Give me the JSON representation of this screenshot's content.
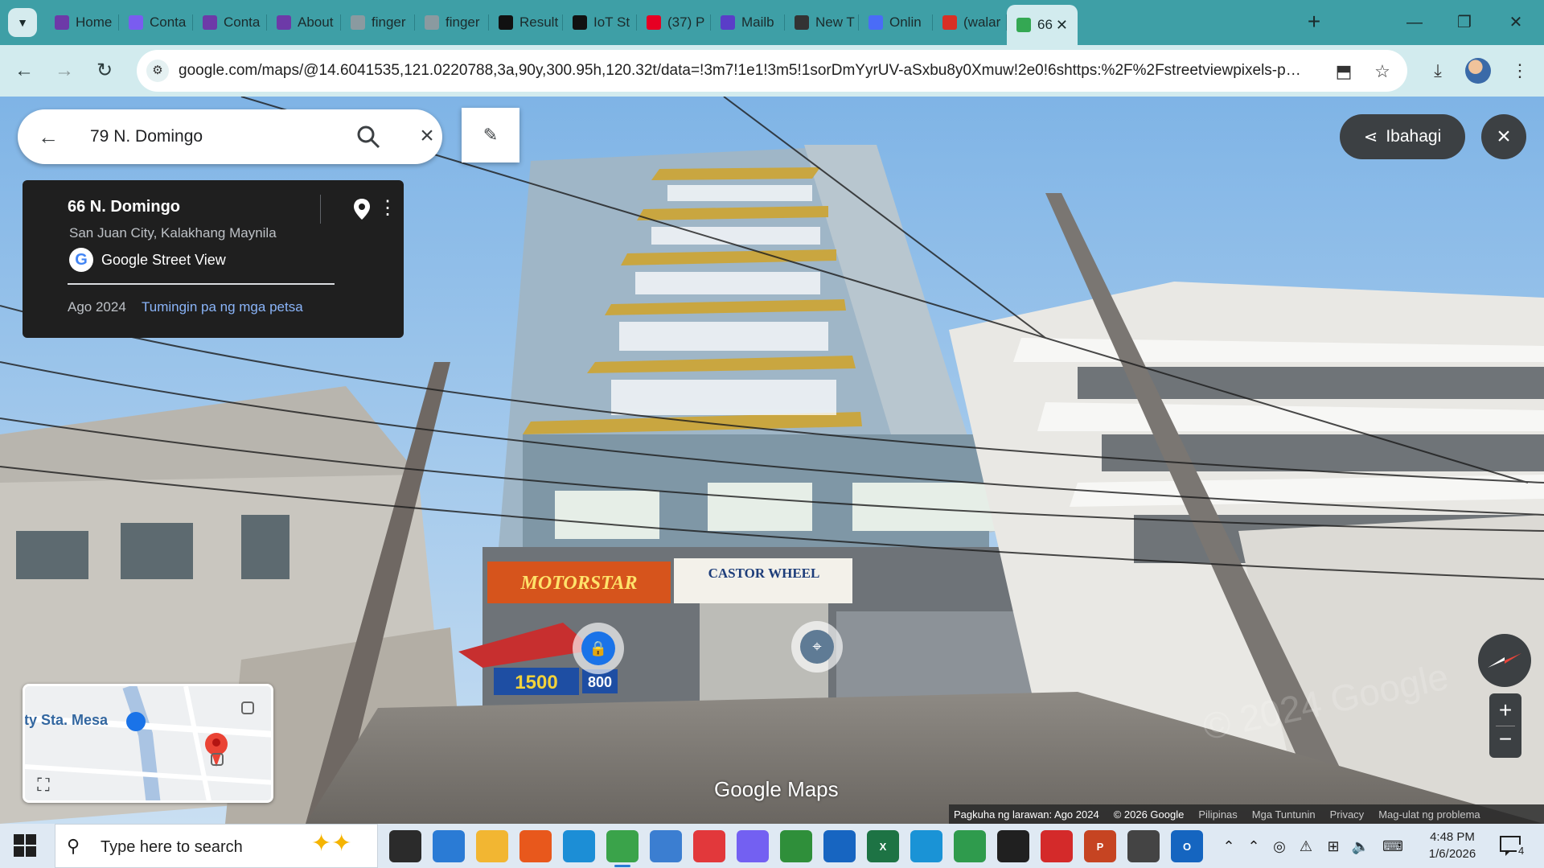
{
  "tabs": [
    {
      "label": "Home",
      "favicon": "wix-cart-icon",
      "color": "#6d3aa8"
    },
    {
      "label": "Conta",
      "favicon": "wix-forms-icon",
      "color": "#7a5cf0"
    },
    {
      "label": "Conta",
      "favicon": "wix-cart-icon",
      "color": "#6d3aa8"
    },
    {
      "label": "About",
      "favicon": "wix-cart-icon",
      "color": "#6d3aa8"
    },
    {
      "label": "finger",
      "favicon": "globe-icon",
      "color": "#8a9aa0"
    },
    {
      "label": "finger",
      "favicon": "globe-icon",
      "color": "#8a9aa0"
    },
    {
      "label": "Result",
      "favicon": "wix-icon",
      "color": "#111111"
    },
    {
      "label": "IoT St",
      "favicon": "wix-icon",
      "color": "#111111"
    },
    {
      "label": "(37) P",
      "favicon": "pinterest-icon",
      "color": "#e60023"
    },
    {
      "label": "Mailb",
      "favicon": "mail-icon",
      "color": "#5a3ec8"
    },
    {
      "label": "New T",
      "favicon": "chrome-icon",
      "color": "#333333"
    },
    {
      "label": "Onlin",
      "favicon": "circle-icon",
      "color": "#4a6cf7"
    },
    {
      "label": "(walar",
      "favicon": "gmail-icon",
      "color": "#d93025"
    },
    {
      "label": "66",
      "favicon": "maps-pin-icon",
      "color": "#34a853"
    }
  ],
  "browser": {
    "url": "google.com/maps/@14.6041535,121.0220788,3a,90y,300.95h,120.32t/data=!3m7!1e1!3m5!1sorDmYyrUV-aSxbu8y0Xmuw!2e0!6shttps:%2F%2Fstreetviewpixels-pa...",
    "accent": "#3e9fa6",
    "toolbar_bg": "#d2ebee"
  },
  "maps": {
    "search_value": "79 N. Domingo",
    "place_title": "66 N. Domingo",
    "place_subtitle": "San Juan City, Kalakhang Maynila",
    "source_label": "Google Street View",
    "image_date": "Ago 2024",
    "more_dates_link": "Tumingin pa ng mga petsa",
    "share_label": "Ibahagi",
    "minimap_label": "ity Sta. Mesa",
    "logo": "Google Maps",
    "footer": {
      "capture": "Pagkuha ng larawan: Ago 2024",
      "copyright": "© 2026 Google",
      "country": "Pilipinas",
      "terms": "Mga Tuntunin",
      "privacy": "Privacy",
      "report": "Mag-ulat ng problema"
    },
    "signs": {
      "left_shop": "MOTORSTAR",
      "right_shop": "CASTOR WHEEL",
      "price_1": "1500",
      "price_2": "800"
    }
  },
  "taskbar": {
    "search_placeholder": "Type here to search",
    "time": "4:48 PM",
    "date": "1/6/2026",
    "notifications": "4",
    "apps": [
      {
        "name": "task-view-icon",
        "label": "",
        "color": "#2b2b2b"
      },
      {
        "name": "store-icon",
        "label": "",
        "color": "#2a7bd5"
      },
      {
        "name": "file-explorer-icon",
        "label": "",
        "color": "#f2b632"
      },
      {
        "name": "firefox-icon",
        "label": "",
        "color": "#e8581c"
      },
      {
        "name": "edge-icon",
        "label": "",
        "color": "#1c8ed6"
      },
      {
        "name": "chrome-icon",
        "label": "",
        "color": "#3aa34a"
      },
      {
        "name": "news-icon",
        "label": "",
        "color": "#3b7ed1"
      },
      {
        "name": "anydesk-icon",
        "label": "",
        "color": "#e2383b"
      },
      {
        "name": "viber-icon",
        "label": "",
        "color": "#7360f2"
      },
      {
        "name": "calculator-icon",
        "label": "",
        "color": "#2f8f3a"
      },
      {
        "name": "outlook-classic-icon",
        "label": "",
        "color": "#1765c1"
      },
      {
        "name": "excel-icon",
        "label": "X",
        "color": "#1d7344"
      },
      {
        "name": "remote-icon",
        "label": "",
        "color": "#1a93d6"
      },
      {
        "name": "vpn-icon",
        "label": "",
        "color": "#2f9b4d"
      },
      {
        "name": "terminal-icon",
        "label": "",
        "color": "#202020"
      },
      {
        "name": "security-icon",
        "label": "",
        "color": "#d42a2a"
      },
      {
        "name": "powerpoint-icon",
        "label": "P",
        "color": "#c64422"
      },
      {
        "name": "settings-icon",
        "label": "",
        "color": "#444444"
      },
      {
        "name": "outlook-icon",
        "label": "O",
        "color": "#1565c0"
      }
    ]
  }
}
